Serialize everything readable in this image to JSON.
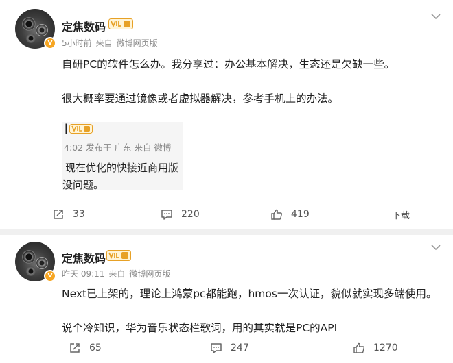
{
  "posts": [
    {
      "author": "定焦数码",
      "time": "5小时前",
      "source_prefix": "来自",
      "source": "微博网页版",
      "lines": [
        "自研PC的软件怎么办。我分享过：办公基本解决，生态还是欠缺一些。",
        "很大概率要通过镜像或者虚拟器解决，参考手机上的办法。"
      ],
      "quote": {
        "meta": "4:02 发布于 广东 来自 微博",
        "lines": [
          "现在优化的快接近商用版",
          "没问题。"
        ]
      },
      "actions": {
        "share": "33",
        "comment": "220",
        "like": "419",
        "more": "下载"
      }
    },
    {
      "author": "定焦数码",
      "time": "昨天 09:11",
      "source_prefix": "来自",
      "source": "微博网页版",
      "lines": [
        "Next已上架的，理论上鸿蒙pc都能跑，hmos一次认证，貌似就实现多端使用。",
        "说个冷知识，华为音乐状态栏歌词，用的其实就是PC的API"
      ],
      "actions": {
        "share": "65",
        "comment": "247",
        "like": "1270"
      }
    }
  ],
  "colors": {
    "vip_gold": "#e7a126",
    "verified_orange": "#f6a623",
    "card_bg": "#ffffff",
    "page_bg": "#f0f0f0"
  },
  "icons": [
    "share-icon",
    "comment-icon",
    "like-icon",
    "chevron-down-icon",
    "vip-badge-icon",
    "verified-icon"
  ]
}
